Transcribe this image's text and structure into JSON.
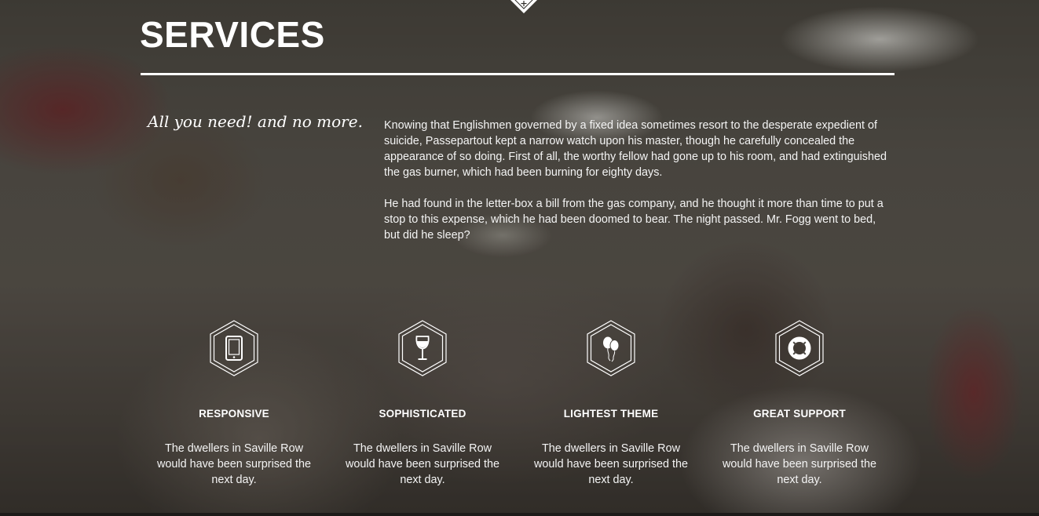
{
  "section": {
    "title": "SERVICES",
    "tagline": "All you need! and no more.",
    "paragraphs": [
      "Knowing that Englishmen governed by a fixed idea sometimes resort to the desperate expedient of suicide, Passepartout kept a narrow watch upon his master, though he carefully concealed the appearance of so doing. First of all, the worthy fellow had gone up to his room, and had extinguished the gas burner, which had been burning for eighty days.",
      "He had found in the letter-box a bill from the gas company, and he thought it more than time to put a stop to this expense, which he had been doomed to bear. The night passed. Mr. Fogg went to bed, but did he sleep?"
    ]
  },
  "services": [
    {
      "icon": "tablet-icon",
      "title": "RESPONSIVE",
      "text": "The dwellers in Saville Row would have been surprised the next day."
    },
    {
      "icon": "wine-glass-icon",
      "title": "SOPHISTICATED",
      "text": "The dwellers in Saville Row would have been surprised the next day."
    },
    {
      "icon": "balloons-icon",
      "title": "LIGHTEST THEME",
      "text": "The dwellers in Saville Row would have been surprised the next day."
    },
    {
      "icon": "life-ring-icon",
      "title": "GREAT SUPPORT",
      "text": "The dwellers in Saville Row would have been surprised the next day."
    }
  ],
  "nav": {
    "notch_icon": "plus-icon"
  },
  "colors": {
    "text": "#ffffff",
    "accent": "#ffffff"
  }
}
